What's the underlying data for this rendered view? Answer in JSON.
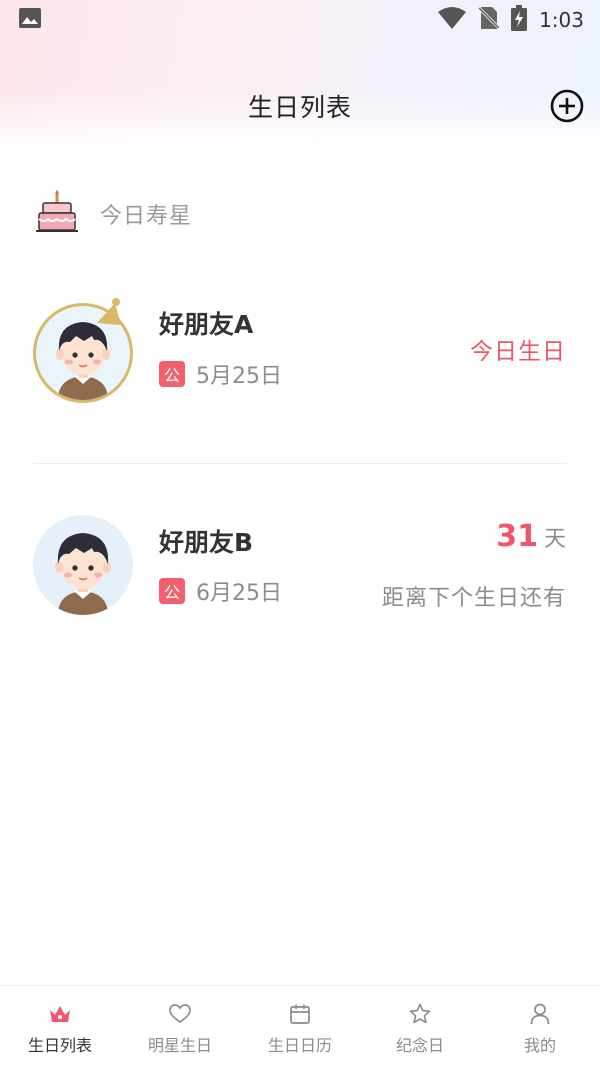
{
  "status_bar": {
    "time": "1:03"
  },
  "header": {
    "title": "生日列表"
  },
  "section": {
    "title": "今日寿星"
  },
  "birthdays": [
    {
      "name": "好朋友A",
      "calendar_badge": "公",
      "date": "5月25日",
      "status": "今日生日"
    },
    {
      "name": "好朋友B",
      "calendar_badge": "公",
      "date": "6月25日",
      "days_left": "31",
      "days_unit": "天",
      "countdown_label": "距离下个生日还有"
    }
  ],
  "tabs": [
    {
      "label": "生日列表",
      "icon": "crown-icon",
      "active": true
    },
    {
      "label": "明星生日",
      "icon": "heart-icon",
      "active": false
    },
    {
      "label": "生日日历",
      "icon": "calendar-icon",
      "active": false
    },
    {
      "label": "纪念日",
      "icon": "star-icon",
      "active": false
    },
    {
      "label": "我的",
      "icon": "user-icon",
      "active": false
    }
  ],
  "colors": {
    "accent": "#f0566a",
    "badge": "#f0606f",
    "avatar_ring": "#d9b867"
  }
}
